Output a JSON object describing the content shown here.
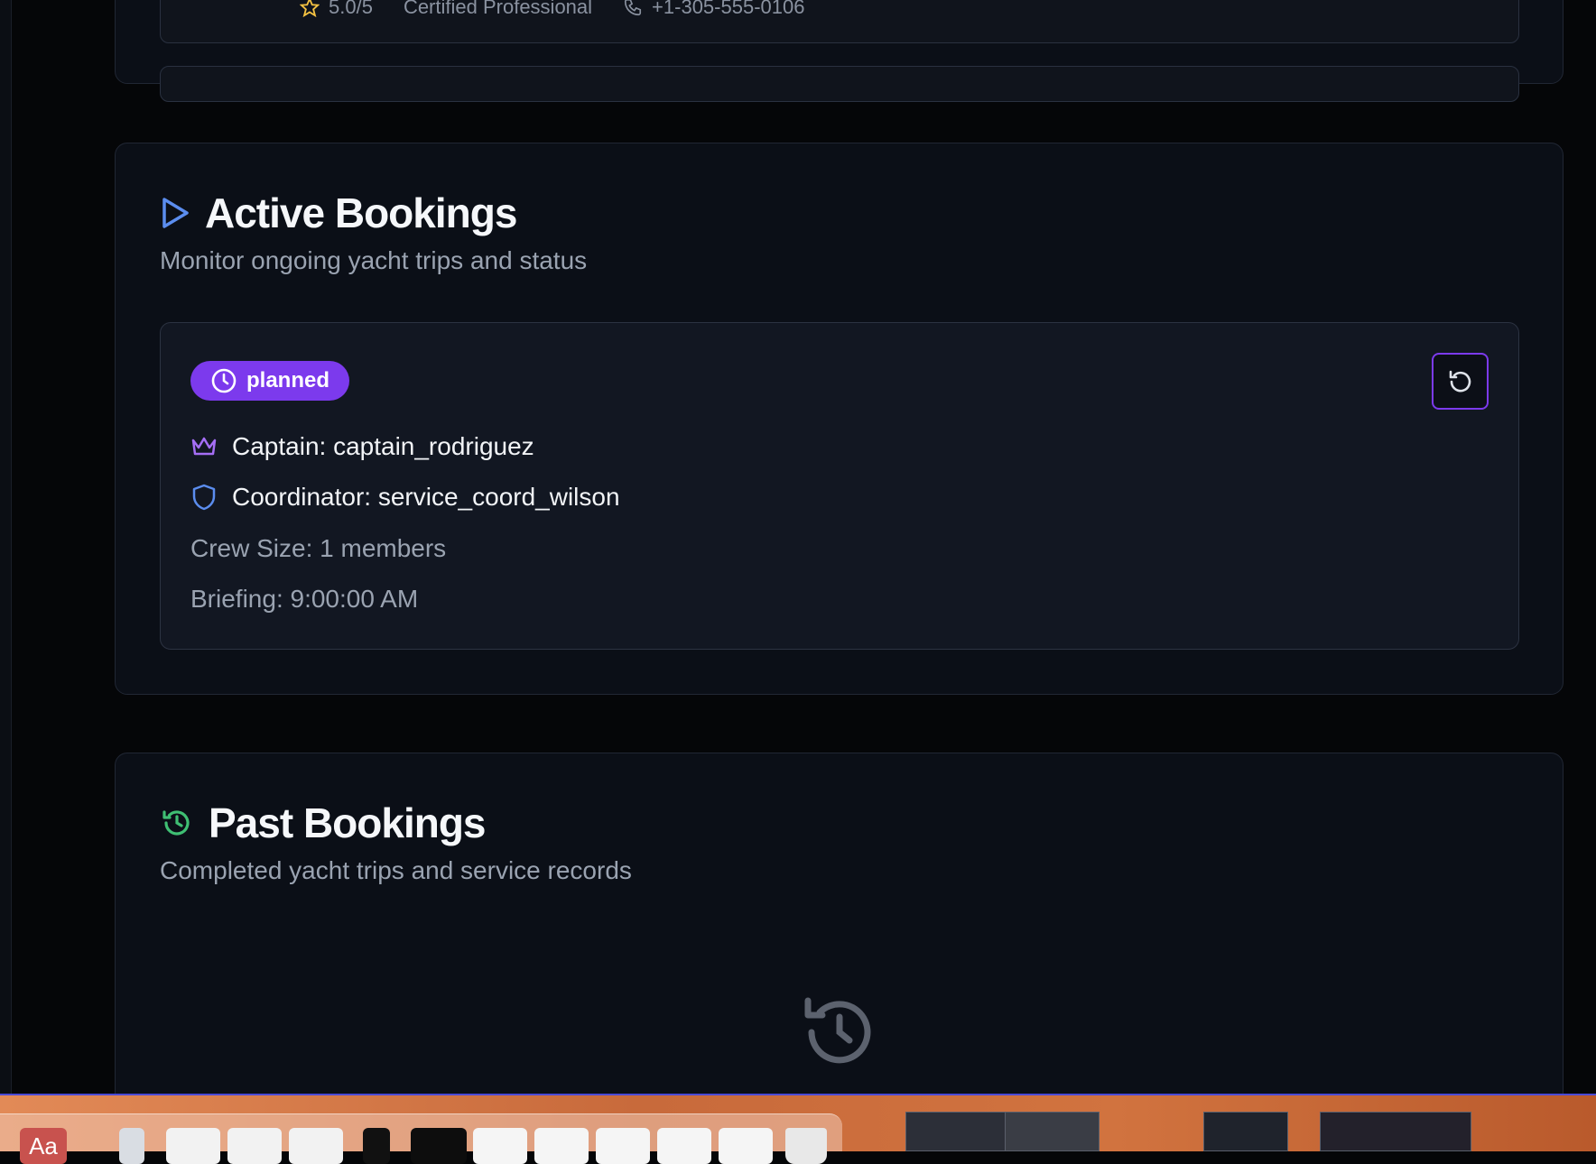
{
  "top_vendor": {
    "rating": "5.0/5",
    "certification": "Certified Professional",
    "phone": "+1-305-555-0106"
  },
  "active_bookings": {
    "title": "Active Bookings",
    "subtitle": "Monitor ongoing yacht trips and status",
    "icon": "play-icon",
    "booking": {
      "status": "planned",
      "status_icon": "clock-icon",
      "captain": "Captain: captain_rodriguez",
      "coordinator": "Coordinator: service_coord_wilson",
      "crew_size": "Crew Size: 1 members",
      "briefing": "Briefing: 9:00:00 AM",
      "status_color": "#7c3aed"
    }
  },
  "past_bookings": {
    "title": "Past Bookings",
    "subtitle": "Completed yacht trips and service records",
    "icon": "history-icon"
  },
  "dock": {
    "first_app_label": "Aa"
  }
}
